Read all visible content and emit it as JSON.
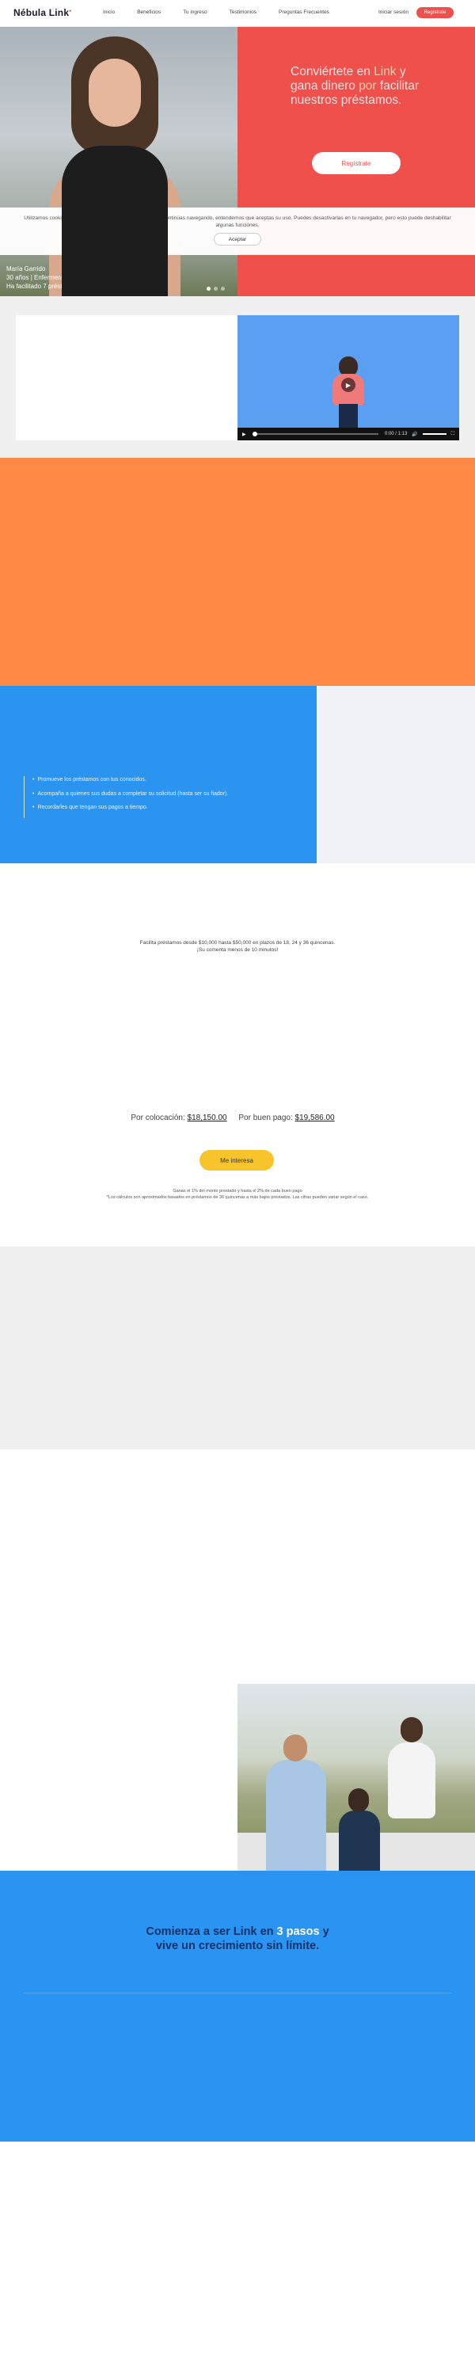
{
  "nav": {
    "logo": "Nébula Link",
    "links": [
      "Inicio",
      "Beneficios",
      "Tu ingreso",
      "Testimonios",
      "Preguntas Frecuentes"
    ],
    "login": "Iniciar sesión",
    "register": "Regístrate"
  },
  "hero": {
    "title_pre": "Conviértete en ",
    "title_hl1": "Link",
    "title_mid": " y gana dinero ",
    "title_hl2": "por",
    "title_post": " facilitar nuestros préstamos.",
    "button": "Regístrate",
    "caption_name": "María Garrido",
    "caption_info": "30 años | Enfermera",
    "caption_loans": "Ha facilitado 7 préstamos",
    "accent_color": "#f0504c"
  },
  "cookie": {
    "text": "Utilizamos cookies para brindarte una mejor experiencia. Si continúas navegando, entendemos que aceptas su uso. Puedes desactivarlas en tu navegador, pero esto puede deshabilitar algunas funciones.",
    "button": "Aceptar"
  },
  "video": {
    "time": "0:00 / 1:13"
  },
  "benefits": [
    "Promueve los préstamos con tus conocidos.",
    "Acompaña a quienes sus dudas a completar su solicitud (hasta ser su fiador).",
    "Recordarles que tengan sus pagos a tiempo."
  ],
  "pricing": {
    "note_line1": "Facilita préstamos desde $10,000 hasta $50,000 en plazos de 18, 24 y 36 quincenas.",
    "note_line2": "¡Su comenta menos de 10 minutos!",
    "colocacion_label": "Por colocación:",
    "colocacion_value": "$18,150.00",
    "buen_pago_label": "Por buen pago:",
    "buen_pago_value": "$19,586.00",
    "cta": "Me interesa",
    "fine1": "Ganas el 1% del monto prestado y hasta el 2% de cada buen pago",
    "fine2": "*Los cálculos son aproximados basados en préstamos de 36 quincenas a más bajos prestados. Las cifras pueden variar según el caso."
  },
  "steps": {
    "title_pre": "Comienza a ser Link en ",
    "title_hl": "3 pasos",
    "title_mid": " y",
    "title_line2": "vive un crecimiento sin límite."
  }
}
